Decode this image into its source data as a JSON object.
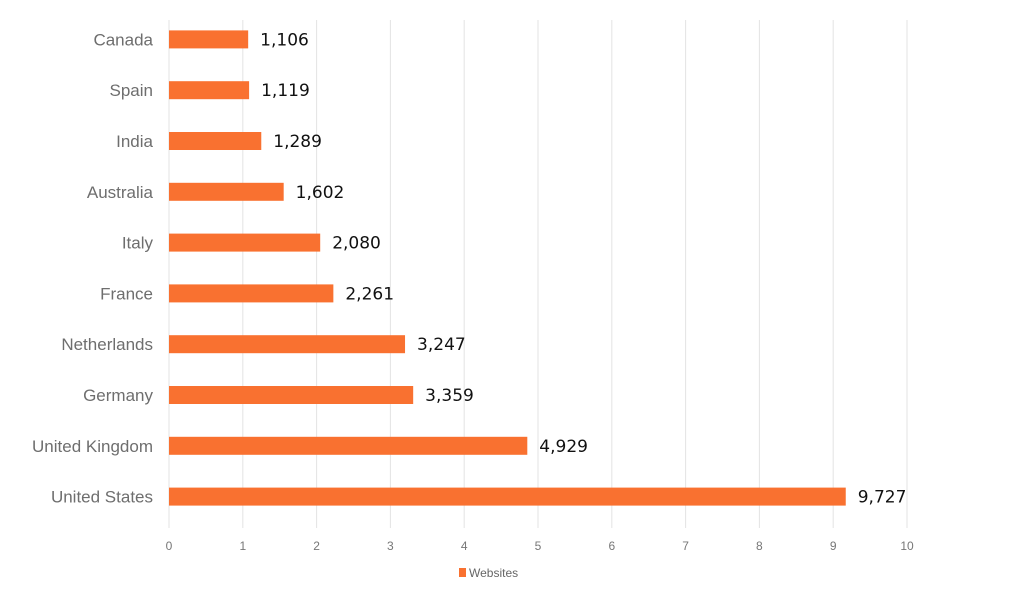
{
  "chart_data": {
    "type": "bar",
    "orientation": "horizontal",
    "title": "",
    "xlabel": "",
    "ylabel": "",
    "categories": [
      "Canada",
      "Spain",
      "India",
      "Australia",
      "Italy",
      "France",
      "Netherlands",
      "Germany",
      "United Kingdom",
      "United States"
    ],
    "series": [
      {
        "name": "Websites",
        "color": "#F97130",
        "values": [
          1106,
          1119,
          1289,
          1602,
          2080,
          2261,
          3247,
          3359,
          4929,
          9727
        ],
        "data_labels": [
          "1,106",
          "1,119",
          "1,289",
          "1,602",
          "2,080",
          "2,261",
          "3,247",
          "3,359",
          "4,929",
          "9,727"
        ]
      }
    ],
    "xlim": [
      0,
      10
    ],
    "x_ticks": [
      "0",
      "1",
      "2",
      "3",
      "4",
      "5",
      "6",
      "7",
      "8",
      "9",
      "10"
    ],
    "grid": true,
    "legend": {
      "position": "bottom",
      "entries": [
        "Websites"
      ]
    }
  }
}
